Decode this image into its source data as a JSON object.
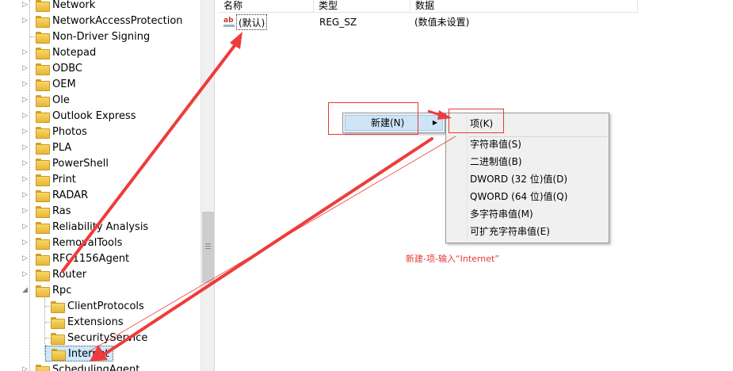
{
  "tree": {
    "nodes": [
      {
        "label": "Network",
        "expander": true
      },
      {
        "label": "NetworkAccessProtection",
        "expander": true
      },
      {
        "label": "Non-Driver Signing",
        "expander": false
      },
      {
        "label": "Notepad",
        "expander": true
      },
      {
        "label": "ODBC",
        "expander": true
      },
      {
        "label": "OEM",
        "expander": true
      },
      {
        "label": "Ole",
        "expander": true
      },
      {
        "label": "Outlook Express",
        "expander": true
      },
      {
        "label": "Photos",
        "expander": true
      },
      {
        "label": "PLA",
        "expander": true
      },
      {
        "label": "PowerShell",
        "expander": true
      },
      {
        "label": "Print",
        "expander": true
      },
      {
        "label": "RADAR",
        "expander": true
      },
      {
        "label": "Ras",
        "expander": true
      },
      {
        "label": "Reliability Analysis",
        "expander": true
      },
      {
        "label": "RemovalTools",
        "expander": true
      },
      {
        "label": "RFC1156Agent",
        "expander": true
      },
      {
        "label": "Router",
        "expander": true
      },
      {
        "label": "Rpc",
        "expander": "open"
      }
    ],
    "rpc_children": [
      {
        "label": "ClientProtocols"
      },
      {
        "label": "Extensions"
      },
      {
        "label": "SecurityService"
      },
      {
        "label": "Internet"
      }
    ],
    "after": {
      "label": "SchedulingAgent",
      "expander": true
    }
  },
  "list": {
    "columns": {
      "name": "名称",
      "type": "类型",
      "data": "数据"
    },
    "rows": [
      {
        "icon": "ab",
        "name": "(默认)",
        "type": "REG_SZ",
        "data": "(数值未设置)"
      }
    ]
  },
  "context_menu": {
    "item": "新建(N)",
    "arrow": "▶"
  },
  "submenu": {
    "key": "项(K)",
    "items": [
      "字符串值(S)",
      "二进制值(B)",
      "DWORD (32 位)值(D)",
      "QWORD (64 位)值(Q)",
      "多字符串值(M)",
      "可扩充字符串值(E)"
    ]
  },
  "annotation": {
    "note": "新建-项-输入“Internet”",
    "color": "#e53935"
  }
}
